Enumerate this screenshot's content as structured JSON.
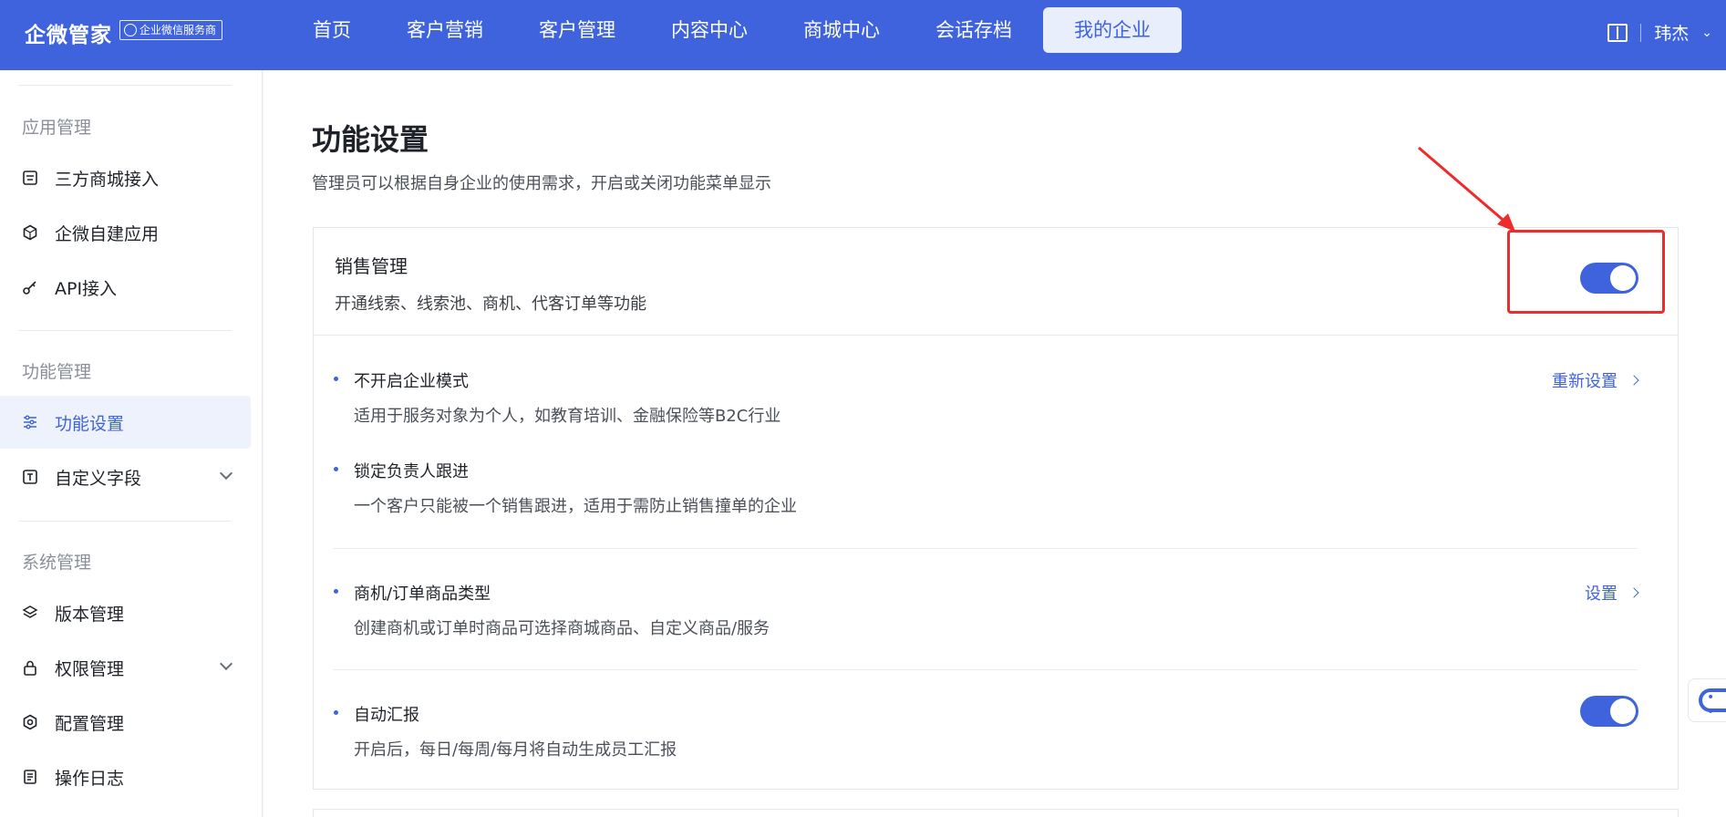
{
  "topbar": {
    "brand": "企微管家",
    "badge": "企业微信服务商",
    "nav": [
      "首页",
      "客户营销",
      "客户管理",
      "内容中心",
      "商城中心",
      "会话存档",
      "我的企业"
    ],
    "active_nav": "我的企业",
    "user": "玮杰"
  },
  "sidebar": {
    "groups": [
      {
        "label": "应用管理",
        "items": [
          {
            "label": "三方商城接入",
            "icon": "shop-link-icon"
          },
          {
            "label": "企微自建应用",
            "icon": "cube-icon"
          },
          {
            "label": "API接入",
            "icon": "key-icon"
          }
        ]
      },
      {
        "label": "功能管理",
        "items": [
          {
            "label": "功能设置",
            "icon": "sliders-icon",
            "active": true
          },
          {
            "label": "自定义字段",
            "icon": "text-field-icon",
            "expandable": true
          }
        ]
      },
      {
        "label": "系统管理",
        "items": [
          {
            "label": "版本管理",
            "icon": "layers-icon"
          },
          {
            "label": "权限管理",
            "icon": "lock-icon",
            "expandable": true
          },
          {
            "label": "配置管理",
            "icon": "hex-gear-icon"
          },
          {
            "label": "操作日志",
            "icon": "log-icon"
          }
        ]
      }
    ]
  },
  "main": {
    "title": "功能设置",
    "description": "管理员可以根据自身企业的使用需求，开启或关闭功能菜单显示",
    "card": {
      "title": "销售管理",
      "description": "开通线索、线索池、商机、代客订单等功能",
      "enabled": true,
      "features": [
        {
          "title": "不开启企业模式",
          "desc": "适用于服务对象为个人，如教育培训、金融保险等B2C行业",
          "link": "重新设置"
        },
        {
          "title": "锁定负责人跟进",
          "desc": "一个客户只能被一个销售跟进，适用于需防止销售撞单的企业"
        },
        {
          "title": "商机/订单商品类型",
          "desc": "创建商机或订单时商品可选择商城商品、自定义商品/服务",
          "link": "设置"
        },
        {
          "title": "自动汇报",
          "desc": "开启后，每日/每周/每月将自动生成员工汇报",
          "enabled": true
        }
      ]
    }
  },
  "colors": {
    "primary": "#3f63dd",
    "highlight": "#ef2b2b"
  }
}
